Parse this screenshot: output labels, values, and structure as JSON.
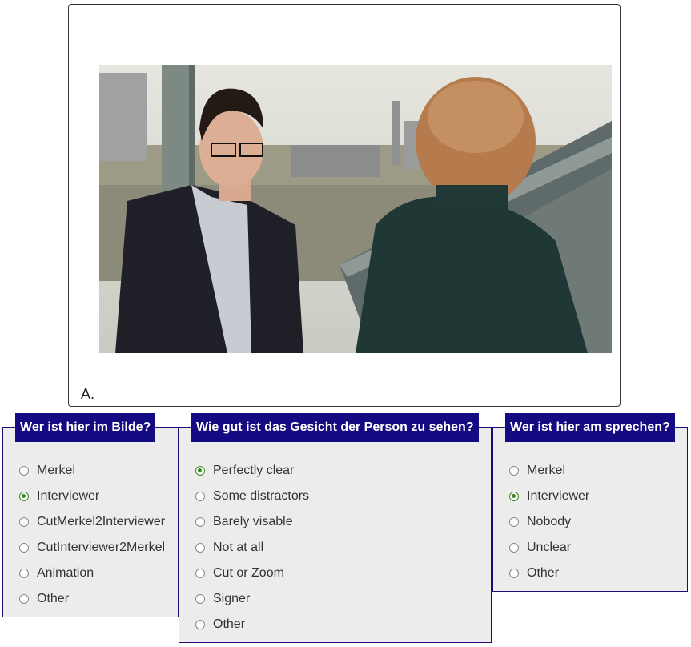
{
  "image_card": {
    "caption": "A."
  },
  "panels": [
    {
      "title": "Wer ist hier im Bilde?",
      "options": [
        {
          "label": "Merkel",
          "checked": false
        },
        {
          "label": "Interviewer",
          "checked": true
        },
        {
          "label": "CutMerkel2Interviewer",
          "checked": false
        },
        {
          "label": "CutInterviewer2Merkel",
          "checked": false
        },
        {
          "label": "Animation",
          "checked": false
        },
        {
          "label": "Other",
          "checked": false
        }
      ]
    },
    {
      "title": "Wie gut ist das Gesicht der Person zu sehen?",
      "options": [
        {
          "label": "Perfectly clear",
          "checked": true
        },
        {
          "label": "Some distractors",
          "checked": false
        },
        {
          "label": "Barely visable",
          "checked": false
        },
        {
          "label": "Not at all",
          "checked": false
        },
        {
          "label": "Cut or Zoom",
          "checked": false
        },
        {
          "label": "Signer",
          "checked": false
        },
        {
          "label": "Other",
          "checked": false
        }
      ]
    },
    {
      "title": "Wer ist hier am sprechen?",
      "options": [
        {
          "label": "Merkel",
          "checked": false
        },
        {
          "label": "Interviewer",
          "checked": true
        },
        {
          "label": "Nobody",
          "checked": false
        },
        {
          "label": "Unclear",
          "checked": false
        },
        {
          "label": "Other",
          "checked": false
        }
      ]
    }
  ],
  "colors": {
    "panel_border": "#1a0d7a",
    "title_bg": "#140a82",
    "radio_checked": "#3b8a25",
    "panel_bg": "#ececec"
  }
}
